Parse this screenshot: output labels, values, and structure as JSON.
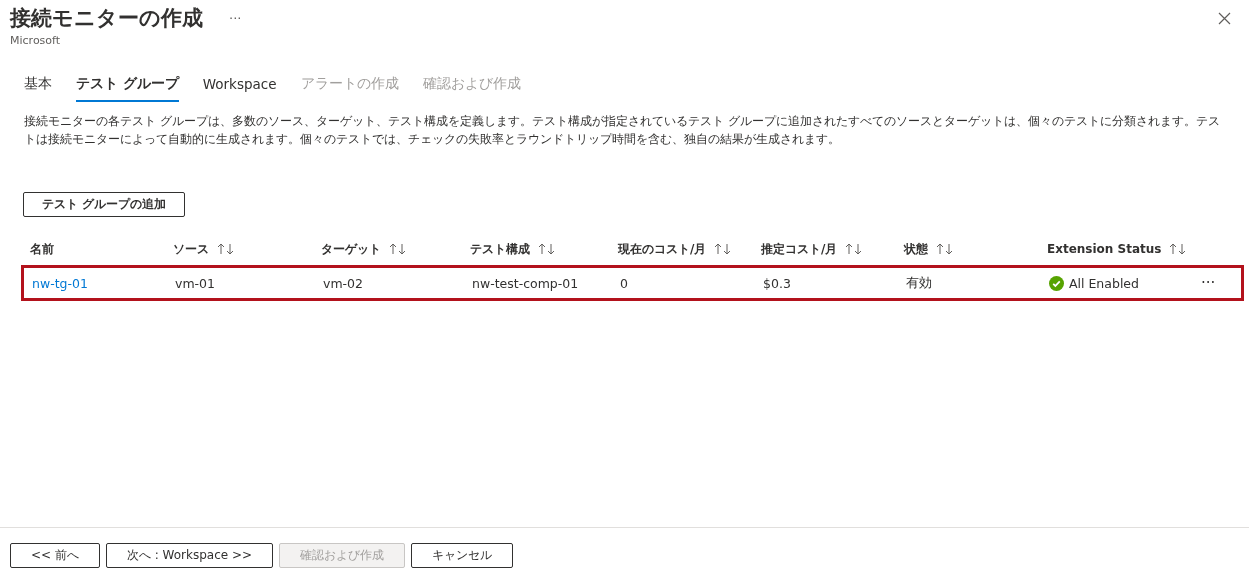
{
  "header": {
    "title": "接続モニターの作成",
    "subtitle": "Microsoft",
    "more": "···"
  },
  "tabs": [
    {
      "label": "基本",
      "selected": false,
      "disabled": false
    },
    {
      "label": "テスト グループ",
      "selected": true,
      "disabled": false
    },
    {
      "label": "Workspace",
      "selected": false,
      "disabled": false
    },
    {
      "label": "アラートの作成",
      "selected": false,
      "disabled": true
    },
    {
      "label": "確認および作成",
      "selected": false,
      "disabled": true
    }
  ],
  "description": "接続モニターの各テスト グループは、多数のソース、ターゲット、テスト構成を定義します。テスト構成が指定されているテスト グループに追加されたすべてのソースとターゲットは、個々のテストに分類されます。テストは接続モニターによって自動的に生成されます。個々のテストでは、チェックの失敗率とラウンドトリップ時間を含む、独自の結果が生成されます。",
  "add_button": "テスト グループの追加",
  "table": {
    "columns": [
      {
        "label": "名前",
        "sortable": false
      },
      {
        "label": "ソース",
        "sortable": true
      },
      {
        "label": "ターゲット",
        "sortable": true
      },
      {
        "label": "テスト構成",
        "sortable": true
      },
      {
        "label": "現在のコスト/月",
        "sortable": true
      },
      {
        "label": "推定コスト/月",
        "sortable": true
      },
      {
        "label": "状態",
        "sortable": true
      },
      {
        "label": "Extension Status",
        "sortable": true
      }
    ],
    "rows": [
      {
        "highlighted": true,
        "name": "nw-tg-01",
        "source": "vm-01",
        "target": "vm-02",
        "test_config": "nw-test-comp-01",
        "current_cost": "0",
        "estimated_cost": "$0.3",
        "state": "有効",
        "extension_status": "All Enabled",
        "more": "···"
      }
    ]
  },
  "footer": {
    "buttons": [
      {
        "label": "<< 前へ",
        "disabled": false
      },
      {
        "label": "次へ : Workspace >>",
        "disabled": false
      },
      {
        "label": "確認および作成",
        "disabled": true
      },
      {
        "label": "キャンセル",
        "disabled": false
      }
    ]
  }
}
